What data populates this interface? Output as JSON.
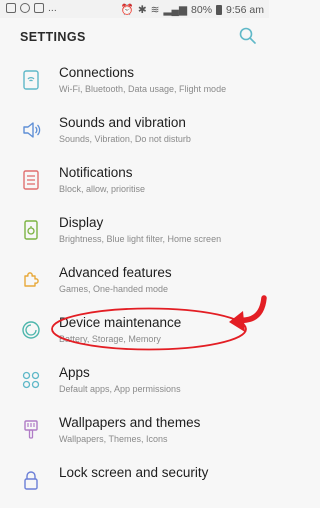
{
  "status_bar": {
    "left_icons": [
      "gallery-icon",
      "whatsapp-icon",
      "flipboard-icon"
    ],
    "left_more": "...",
    "battery": "80%",
    "time": "9:56 am"
  },
  "header": {
    "title": "SETTINGS",
    "search_icon": "search-icon"
  },
  "accent_color": "#5fb8c8",
  "annotation_color": "#e31e24",
  "items": [
    {
      "id": "connections",
      "title": "Connections",
      "subtitle": "Wi-Fi, Bluetooth, Data usage, Flight mode",
      "icon": "connections-icon"
    },
    {
      "id": "sounds",
      "title": "Sounds and vibration",
      "subtitle": "Sounds, Vibration, Do not disturb",
      "icon": "speaker-icon"
    },
    {
      "id": "notifications",
      "title": "Notifications",
      "subtitle": "Block, allow, prioritise",
      "icon": "notifications-icon"
    },
    {
      "id": "display",
      "title": "Display",
      "subtitle": "Brightness, Blue light filter, Home screen",
      "icon": "display-icon"
    },
    {
      "id": "advanced",
      "title": "Advanced features",
      "subtitle": "Games, One-handed mode",
      "icon": "puzzle-icon"
    },
    {
      "id": "device-maintenance",
      "title": "Device maintenance",
      "subtitle": "Battery, Storage, Memory",
      "icon": "device-maintenance-icon"
    },
    {
      "id": "apps",
      "title": "Apps",
      "subtitle": "Default apps, App permissions",
      "icon": "apps-icon"
    },
    {
      "id": "wallpapers",
      "title": "Wallpapers and themes",
      "subtitle": "Wallpapers, Themes, Icons",
      "icon": "paintbrush-icon"
    },
    {
      "id": "lock-screen",
      "title": "Lock screen and security",
      "subtitle": "",
      "icon": "lock-icon"
    }
  ]
}
